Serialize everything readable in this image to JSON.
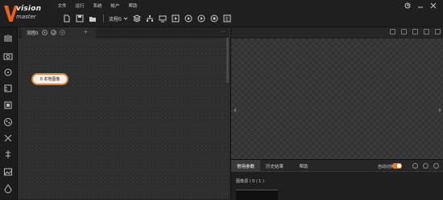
{
  "app": {
    "logo_text": "vision",
    "logo_sub": "master"
  },
  "menu": [
    "文件",
    "运行",
    "系统",
    "帐户",
    "帮助"
  ],
  "toolbar": {
    "process_label": "流程0",
    "icons": [
      "new-file-icon",
      "save-icon",
      "open-folder-icon",
      "process-dropdown-icon",
      "layers-icon",
      "network-icon",
      "monitor-icon",
      "run-once-icon",
      "run-loop-icon",
      "stop-icon",
      "record-icon"
    ]
  },
  "window": {
    "controls": [
      "clock-icon",
      "minimize-icon",
      "close-icon"
    ]
  },
  "workspace": {
    "tab_label": "流程0",
    "add_tab": "+",
    "more": "⋯",
    "node_label": "0 本地图像"
  },
  "right_pane": {
    "tabs": [
      "常用参数",
      "历史结果",
      "帮助"
    ],
    "active_tab": 0,
    "source_label": "图像源 ( 0 / 1 )",
    "auto_switch_label": "自动切换",
    "auto_switch_on": true
  },
  "colors": {
    "accent": "#e07a2e",
    "node_border": "#c9854a",
    "logo_orange": "#e8611c"
  }
}
